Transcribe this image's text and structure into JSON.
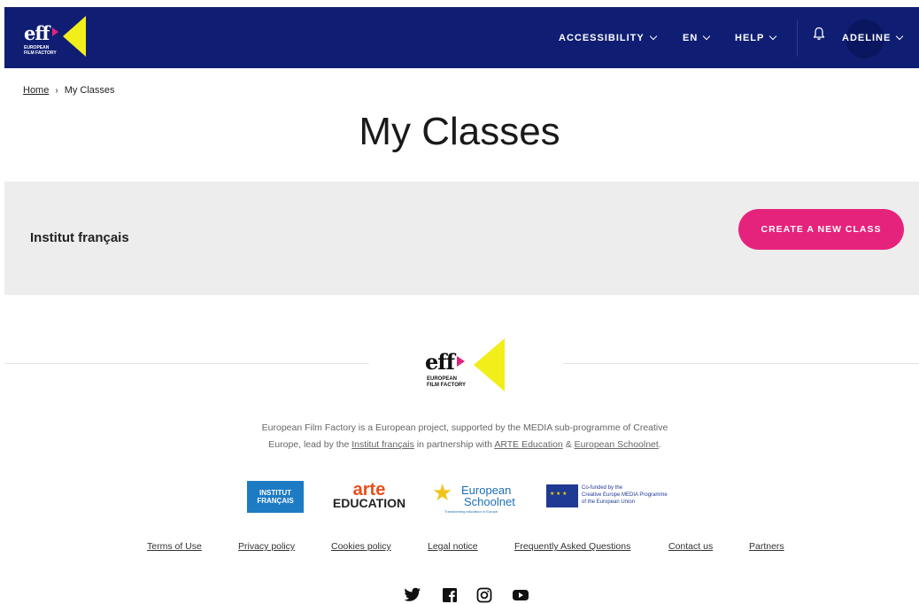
{
  "header": {
    "logo_text": "eff",
    "logo_subtitle_line1": "EUROPEAN",
    "logo_subtitle_line2": "FILM FACTORY",
    "nav": {
      "accessibility": "ACCESSIBILITY",
      "language": "EN",
      "help": "HELP",
      "user": "ADELINE"
    },
    "colors": {
      "bar": "#0f1e73",
      "logo_accent": "#f2ee1a",
      "logo_pink": "#e0247d"
    }
  },
  "breadcrumb": {
    "home": "Home",
    "separator": "›",
    "current": "My Classes"
  },
  "page_title": "My Classes",
  "class_section": {
    "institution": "Institut français",
    "create_button": "CREATE A NEW CLASS",
    "button_color": "#e6237c"
  },
  "footer": {
    "logo_text": "eff",
    "logo_subtitle_line1": "EUROPEAN",
    "logo_subtitle_line2": "FILM FACTORY",
    "about": {
      "text1": "European Film Factory is a European project, supported by the MEDIA sub-programme of Creative Europe, lead by the ",
      "link1": "Institut français",
      "text2": " in partnership with ",
      "link2": "ARTE Education",
      "text3": " & ",
      "link3": "European Schoolnet",
      "text4": "."
    },
    "partners": {
      "institut_line1": "INSTITUT",
      "institut_line2": "FRANÇAIS",
      "arte_line1": "arte",
      "arte_line2": "EDUCATION",
      "schoolnet_line1": "European",
      "schoolnet_line2": "Schoolnet",
      "schoolnet_tagline": "Transforming education in Europe",
      "eu_line1": "Co-funded by the",
      "eu_line2": "Creative Europe MEDIA Programme",
      "eu_line3": "of the European Union"
    },
    "links": {
      "terms": "Terms of Use",
      "privacy": "Privacy policy",
      "cookies": "Cookies policy",
      "legal": "Legal notice",
      "faq": "Frequently Asked Questions",
      "contact": "Contact us",
      "partners": "Partners"
    },
    "social_icons": [
      "twitter-icon",
      "facebook-icon",
      "instagram-icon",
      "youtube-icon"
    ]
  }
}
